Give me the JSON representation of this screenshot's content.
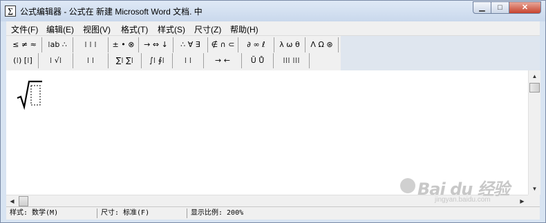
{
  "window": {
    "title": "公式编辑器 - 公式在 新建 Microsoft Word 文档. 中",
    "app_icon": "∑",
    "minimize_label": "▁",
    "maximize_label": "□",
    "close_label": "✕"
  },
  "menu": [
    "文件(F)",
    "编辑(E)",
    "视图(V)",
    "格式(T)",
    "样式(S)",
    "尺寸(Z)",
    "帮助(H)"
  ],
  "toolbar": {
    "row1": [
      "≤ ≠ ≈",
      "⁞ab ∴",
      "⁞ ⁞ ⁞",
      "± • ⊗",
      "→ ⇔ ↓",
      "∴ ∀ ∃",
      "∉ ∩ ⊂",
      "∂ ∞ ℓ",
      "λ ω θ",
      "Λ Ω ⊛"
    ],
    "row2": [
      "(⁞) [⁞]",
      "⁞ √⁞",
      "⁞ ⁞",
      "∑⁞ ∑⁞",
      "∫⁞ ∮⁞",
      "⁞ ⁞",
      "→ ←",
      "Ũ Ů",
      "⁞⁞⁞ ⁞⁞⁞"
    ]
  },
  "editor": {
    "formula": "√[ ]"
  },
  "scrollbars": {
    "up": "▲",
    "down": "▼",
    "left": "◀",
    "right": "▶"
  },
  "status": {
    "style": "样式: 数学(M)",
    "size": "尺寸: 标准(F)",
    "zoom": "显示比例: 200%"
  },
  "watermark": {
    "main": "Bai du 经验",
    "sub": "jingyan.baidu.com"
  },
  "colors": {
    "accent": "#dfe6ef",
    "close": "#c8432e"
  }
}
